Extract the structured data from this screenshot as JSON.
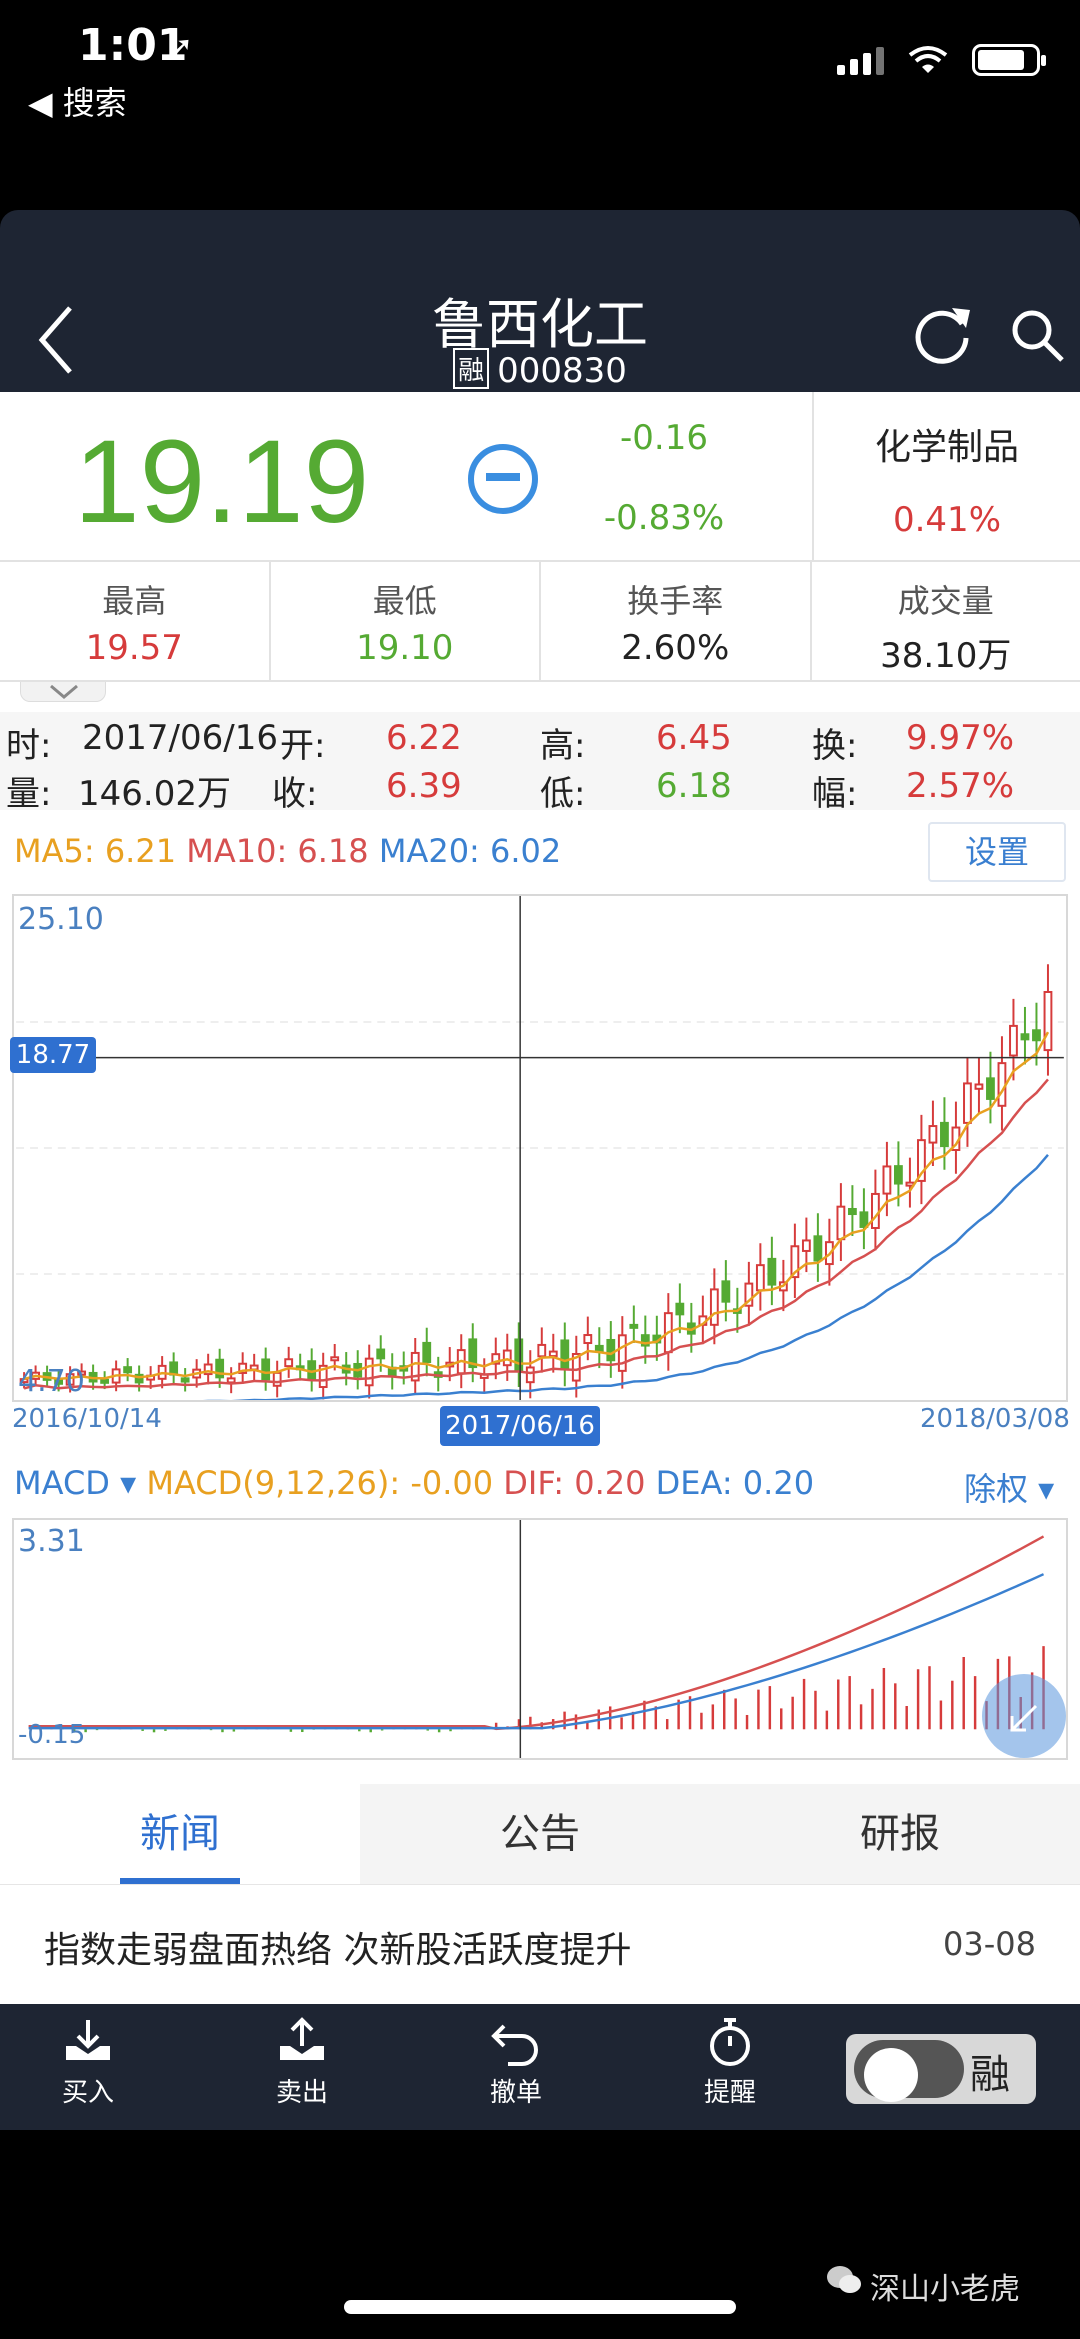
{
  "status_bar": {
    "time": "1:01",
    "location_glyph": "➚",
    "back_label": "◀ 搜索"
  },
  "header": {
    "title": "鲁西化工",
    "rong_tag": "融",
    "code": "000830"
  },
  "quote": {
    "price": "19.19",
    "change": "-0.16",
    "change_pct": "-0.83%",
    "sector_name": "化学制品",
    "sector_pct": "0.41%",
    "price_color": "#55aa33"
  },
  "stats": [
    {
      "label": "最高",
      "value": "19.57",
      "tone": "red"
    },
    {
      "label": "最低",
      "value": "19.10",
      "tone": "green"
    },
    {
      "label": "换手率",
      "value": "2.60%",
      "tone": "dark"
    },
    {
      "label": "成交量",
      "value": "38.10万",
      "tone": "dark"
    }
  ],
  "detail": {
    "time_label": "时:",
    "date": "2017/06/16",
    "open_label": "开:",
    "open": "6.22",
    "high_label": "高:",
    "high": "6.45",
    "turn_label": "换:",
    "turn": "9.97%",
    "vol_label": "量:",
    "vol": "146.02万",
    "close_label": "收:",
    "close": "6.39",
    "low_label": "低:",
    "low": "6.18",
    "amp_label": "幅:",
    "amp": "2.57%"
  },
  "ma": {
    "ma5": "MA5: 6.21",
    "ma10": "MA10: 6.18",
    "ma20": "MA20: 6.02",
    "settings": "设置"
  },
  "kchart": {
    "y_top": "25.10",
    "y_bottom": "4.70",
    "crosshair_price": "18.77",
    "date_start": "2016/10/14",
    "date_cursor": "2017/06/16",
    "date_end": "2018/03/08"
  },
  "macd": {
    "name": "MACD ▾",
    "params": "MACD(9,12,26): -0.00",
    "dif": "DIF: 0.20",
    "dea": "DEA: 0.20",
    "adjust": "除权 ▾",
    "y_top": "3.31",
    "y_bottom": "-0.15"
  },
  "tabs": [
    "新闻",
    "公告",
    "研报"
  ],
  "news": {
    "title": "指数走弱盘面热络 次新股活跃度提升",
    "date": "03-08"
  },
  "toolbar": {
    "buy": "买入",
    "sell": "卖出",
    "cancel": "撤单",
    "alert": "提醒",
    "rong": "融"
  },
  "watermark": "深山小老虎",
  "colors": {
    "up": "#d63b3b",
    "down": "#55aa33",
    "accent": "#2f70d0",
    "ma5": "#e8a020",
    "ma10": "#d65050",
    "ma20": "#3a80d0"
  }
}
